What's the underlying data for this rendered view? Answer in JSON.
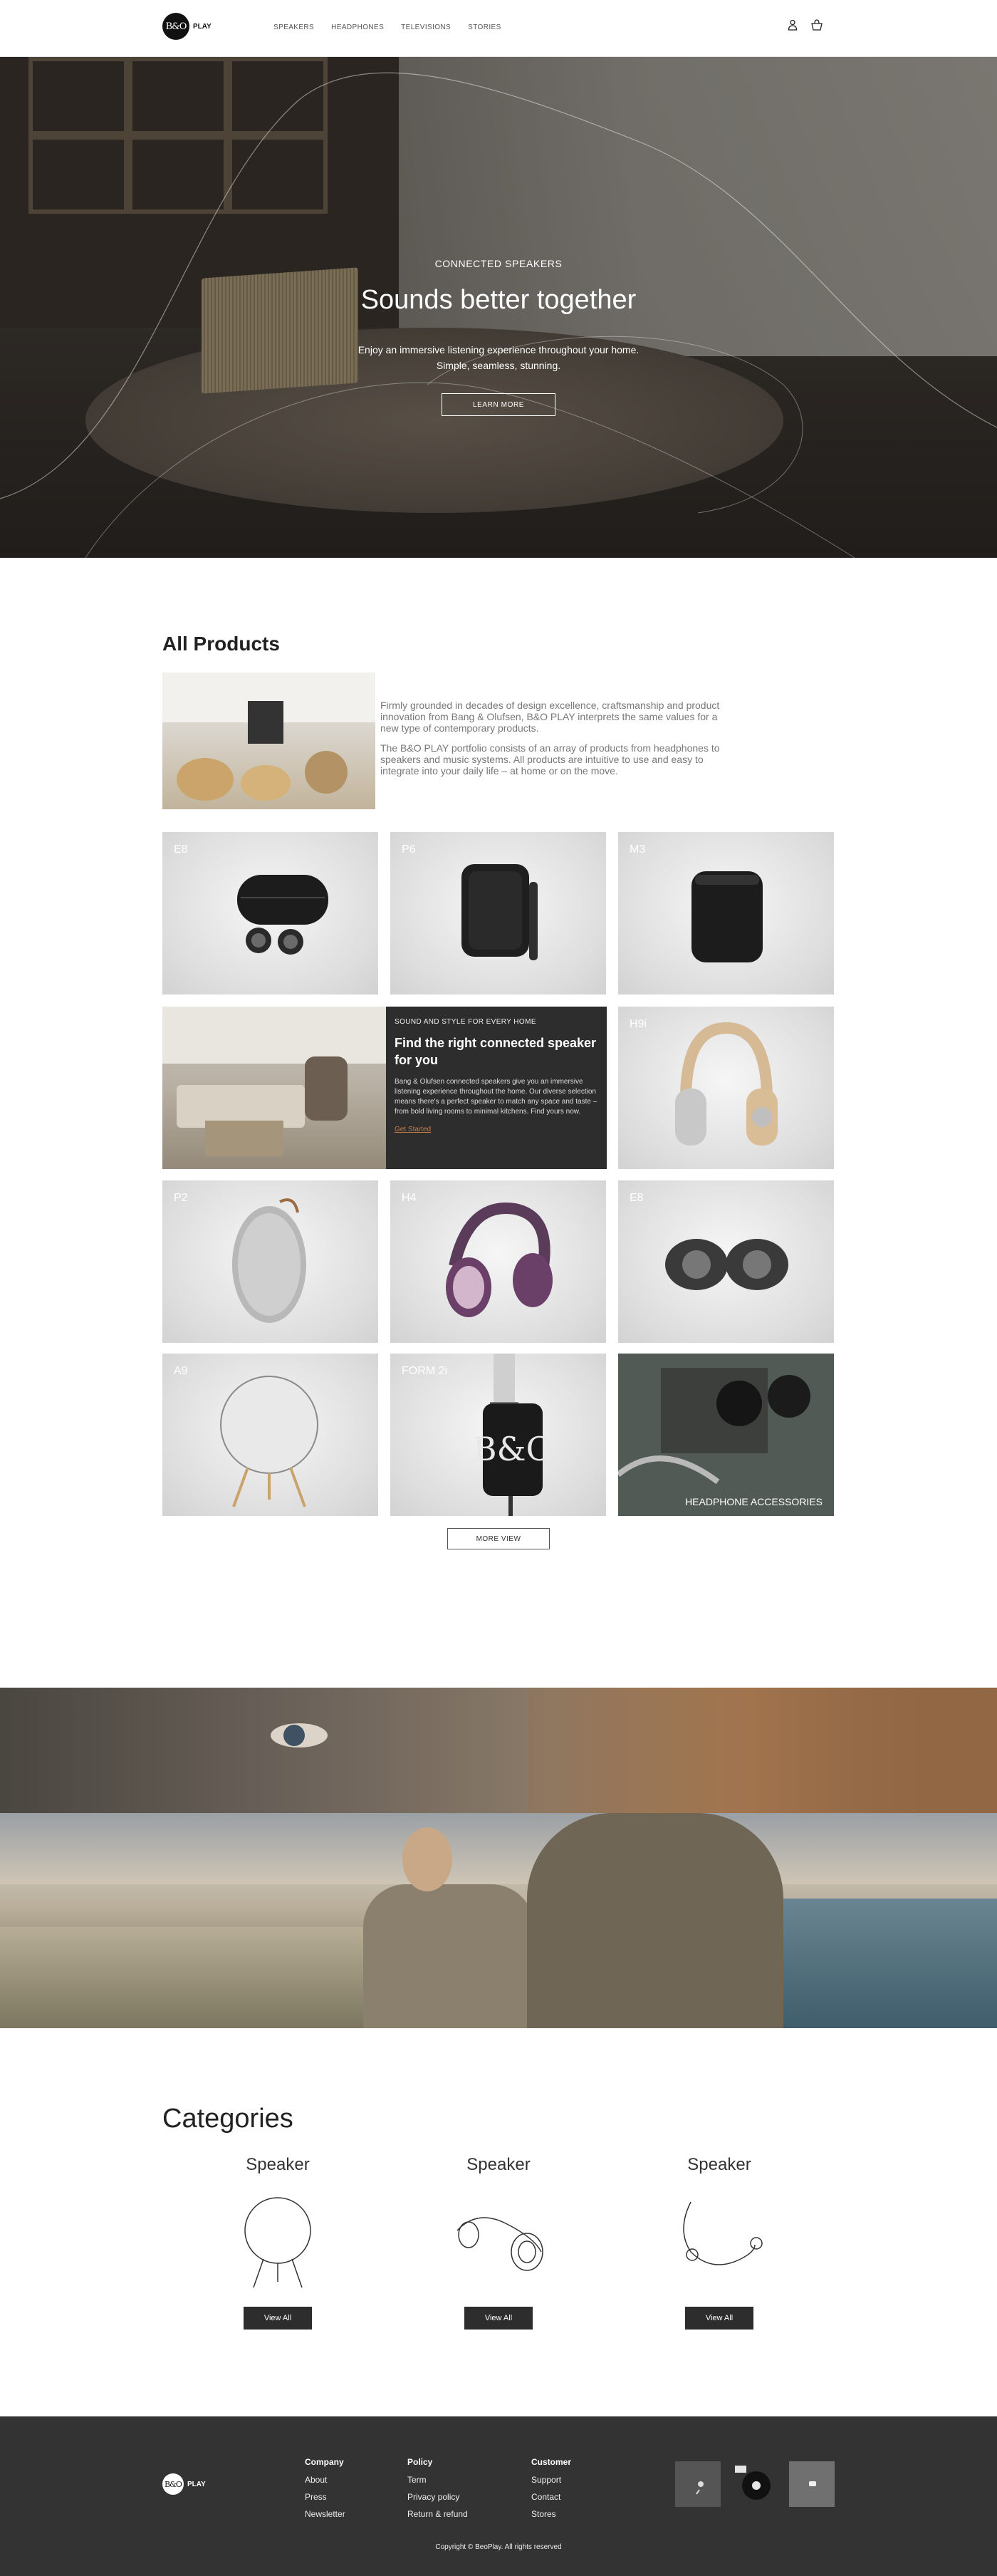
{
  "header": {
    "logo_mark": "B&O",
    "logo_text": "PLAY",
    "nav": [
      "SPEAKERS",
      "HEADPHONES",
      "TELEVISIONS",
      "STORIES"
    ],
    "icons": [
      "user-icon",
      "cart-icon"
    ]
  },
  "hero": {
    "kicker": "CONNECTED SPEAKERS",
    "title": "Sounds better together",
    "desc_line1": "Enjoy an immersive listening experience throughout your home.",
    "desc_line2": "Simple, seamless, stunning.",
    "button": "LEARN MORE"
  },
  "products": {
    "title": "All Products",
    "intro_p1": "Firmly grounded in decades of design excellence, craftsmanship and product innovation from Bang & Olufsen, B&O PLAY interprets the same values for a new type of contemporary products.",
    "intro_p2": "The B&O PLAY portfolio consists of an array of products from headphones to speakers and music systems. All products are intuitive to use and easy to integrate into your daily life – at home or on the move.",
    "cards": [
      "E8",
      "P6",
      "M3",
      "H9i",
      "P2",
      "H4",
      "E8",
      "A9",
      "FORM 2i"
    ],
    "accessories_label": "HEADPHONE ACCESSORIES",
    "more_button": "MORE VIEW"
  },
  "promo": {
    "kicker": "SOUND AND STYLE FOR EVERY HOME",
    "title": "Find the right connected speaker for you",
    "body": "Bang & Olufsen connected speakers give you an immersive listening experience throughout the home. Our diverse selection means there's a perfect speaker to match any space and taste – from bold living rooms to minimal kitchens. Find yours now.",
    "link": "Get Started"
  },
  "categories": {
    "title": "Categories",
    "items": [
      {
        "name": "Speaker",
        "button": "View All"
      },
      {
        "name": "Speaker",
        "button": "View All"
      },
      {
        "name": "Speaker",
        "button": "View All"
      }
    ]
  },
  "footer": {
    "logo_mark": "B&O",
    "logo_text": "PLAY",
    "columns": [
      {
        "title": "Company",
        "links": [
          "About",
          "Press",
          "Newsletter"
        ]
      },
      {
        "title": "Policy",
        "links": [
          "Term",
          "Privacy policy",
          "Return & refund"
        ]
      },
      {
        "title": "Customer",
        "links": [
          "Support",
          "Contact",
          "Stores"
        ]
      }
    ],
    "copyright": "Copyright © BeoPlay. All rights reserved"
  }
}
